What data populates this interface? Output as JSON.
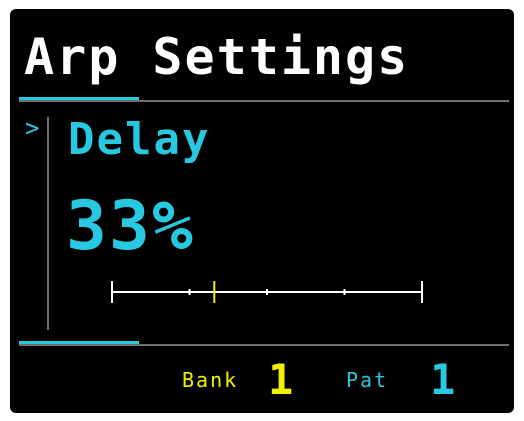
{
  "screen": {
    "title": "Arp Settings",
    "cursor_glyph": ">",
    "parameter": {
      "name": "Delay",
      "value_text": "33%",
      "slider_value": 0.33,
      "slider_ticks": 4
    },
    "footer": {
      "bank_label": "Bank",
      "bank_value": "1",
      "pat_label": "Pat",
      "pat_value": "1"
    }
  },
  "colors": {
    "accent": "#28c8e0",
    "highlight": "#f0f000",
    "text": "#ffffff",
    "background": "#000000",
    "divider": "#707070"
  }
}
